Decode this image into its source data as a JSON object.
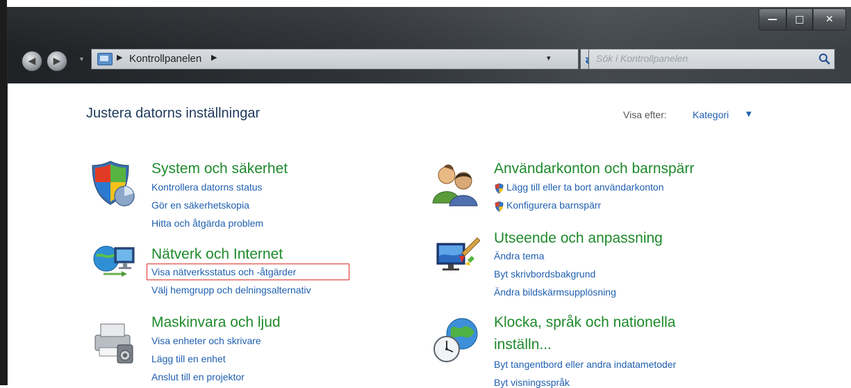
{
  "window": {
    "minimize_glyph": "—",
    "maximize_glyph": "□",
    "close_glyph": "✕"
  },
  "nav": {
    "back_glyph": "◀",
    "forward_glyph": "▶",
    "dropdown_glyph": "▾"
  },
  "address": {
    "separator": "▶",
    "path": "Kontrollpanelen",
    "dropdown_glyph": "▾",
    "refresh_glyph": "⇄"
  },
  "search": {
    "placeholder": "Sök i Kontrollpanelen"
  },
  "header": {
    "title": "Justera datorns inställningar",
    "view_by_label": "Visa efter:",
    "view_by_value": "Kategori",
    "view_by_arrow": "▼"
  },
  "categories": {
    "system": {
      "title": "System och säkerhet",
      "links": [
        "Kontrollera datorns status",
        "Gör en säkerhetskopia",
        "Hitta och åtgärda problem"
      ]
    },
    "network": {
      "title": "Nätverk och Internet",
      "links": [
        "Visa nätverksstatus och -åtgärder",
        "Välj hemgrupp och delningsalternativ"
      ]
    },
    "hardware": {
      "title": "Maskinvara och ljud",
      "links": [
        "Visa enheter och skrivare",
        "Lägg till en enhet",
        "Anslut till en projektor"
      ]
    },
    "users": {
      "title": "Användarkonton och barnspärr",
      "links": [
        "Lägg till eller ta bort användarkonton",
        "Konfigurera barnspärr"
      ]
    },
    "appearance": {
      "title": "Utseende och anpassning",
      "links": [
        "Ändra tema",
        "Byt skrivbordsbakgrund",
        "Ändra bildskärmsupplösning"
      ]
    },
    "clock": {
      "title_line1": "Klocka, språk och nationella",
      "title_line2": "inställn...",
      "links": [
        "Byt tangentbord eller andra indatametoder",
        "Byt visningsspråk"
      ]
    }
  },
  "colors": {
    "category_title": "#1e8a2b",
    "link": "#1f5fb0",
    "highlight": "#d9322c",
    "heading": "#1e395b"
  }
}
